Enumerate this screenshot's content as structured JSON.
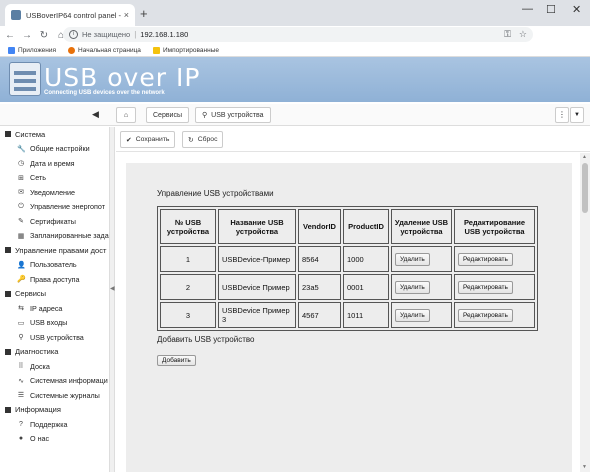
{
  "browser": {
    "tab_title": "USBoverIP64 control panel - USB",
    "tab_close": "×",
    "new_tab": "+",
    "security_label": "Не защищено",
    "url": "192.168.1.180",
    "bookmarks": [
      "Приложения",
      "Начальная страница",
      "Импортированные"
    ]
  },
  "site": {
    "brand": "USB over IP",
    "tagline": "Connecting USB devices over the network"
  },
  "breadcrumbs": [
    "Сервисы",
    "USB устройства"
  ],
  "toolbar": {
    "save_label": "Сохранить",
    "reset_label": "Сброс"
  },
  "sidebar": {
    "sections": [
      {
        "title": "Система",
        "items": [
          {
            "label": "Общие настройки",
            "icon": "wrench-icon",
            "glyph": "🔧"
          },
          {
            "label": "Дата и время",
            "icon": "clock-icon",
            "glyph": "◷"
          },
          {
            "label": "Сеть",
            "icon": "network-icon",
            "glyph": "⊞"
          },
          {
            "label": "Уведомление",
            "icon": "envelope-icon",
            "glyph": "✉"
          },
          {
            "label": "Управление энергопот",
            "icon": "power-icon",
            "glyph": "⏻"
          },
          {
            "label": "Сертификаты",
            "icon": "certificate-icon",
            "glyph": "✎"
          },
          {
            "label": "Запланированные зада",
            "icon": "calendar-icon",
            "glyph": "▦"
          }
        ]
      },
      {
        "title": "Управление правами дост",
        "items": [
          {
            "label": "Пользователь",
            "icon": "user-icon",
            "glyph": "👤"
          },
          {
            "label": "Права доступа",
            "icon": "key-icon",
            "glyph": "🔑"
          }
        ]
      },
      {
        "title": "Сервисы",
        "items": [
          {
            "label": "IP адреса",
            "icon": "ip-icon",
            "glyph": "⇆"
          },
          {
            "label": "USB входы",
            "icon": "usb-port-icon",
            "glyph": "▭"
          },
          {
            "label": "USB устройства",
            "icon": "usb-icon",
            "glyph": "⚲"
          }
        ]
      },
      {
        "title": "Диагностика",
        "items": [
          {
            "label": "Доска",
            "icon": "dashboard-icon",
            "glyph": "⠿"
          },
          {
            "label": "Системная информаци",
            "icon": "chart-icon",
            "glyph": "∿"
          },
          {
            "label": "Системные журналы",
            "icon": "log-icon",
            "glyph": "☰"
          }
        ]
      },
      {
        "title": "Информация",
        "items": [
          {
            "label": "Поддержка",
            "icon": "help-icon",
            "glyph": "?"
          },
          {
            "label": "О нас",
            "icon": "info-icon",
            "glyph": "●"
          }
        ]
      }
    ]
  },
  "main": {
    "panel_title": "Управление USB устройствами",
    "columns": [
      "№ USB устройства",
      "Название USB устройства",
      "VendorID",
      "ProductID",
      "Удаление USB устройства",
      "Редактирование USB устройства"
    ],
    "rows": [
      {
        "num": "1",
        "name": "USBDevice-Пример",
        "vendor": "8564",
        "product": "1000"
      },
      {
        "num": "2",
        "name": "USBDevice Пример",
        "vendor": "23a5",
        "product": "0001"
      },
      {
        "num": "3",
        "name": "USBDevice Пример 3",
        "vendor": "4567",
        "product": "1011"
      }
    ],
    "delete_label": "Удалить",
    "edit_label": "Редактировать",
    "add_title": "Добавить USB устройство",
    "add_button": "Добавить"
  }
}
